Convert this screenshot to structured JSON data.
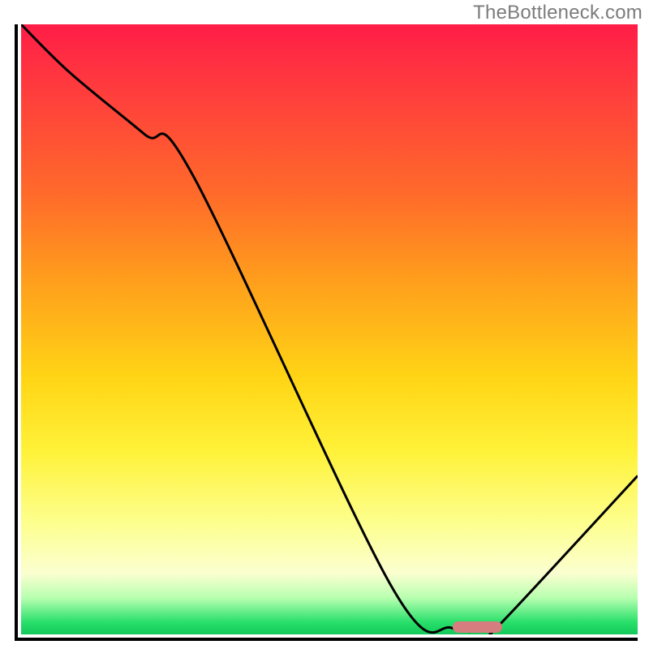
{
  "watermark": "TheBottleneck.com",
  "chart_data": {
    "type": "line",
    "title": "",
    "xlabel": "",
    "ylabel": "",
    "xlim": [
      0,
      100
    ],
    "ylim": [
      0,
      100
    ],
    "grid": false,
    "legend": false,
    "series": [
      {
        "name": "bottleneck-curve",
        "x": [
          0,
          8,
          20,
          28,
          60,
          70,
          76,
          78,
          100
        ],
        "y": [
          100,
          92,
          82,
          75,
          8,
          1,
          1,
          2,
          26
        ]
      }
    ],
    "optimal_range": {
      "x_start": 70,
      "x_end": 78,
      "y": 1
    },
    "gradient_stops": [
      {
        "pos": 0,
        "color": "#ff1d47"
      },
      {
        "pos": 10,
        "color": "#ff3a3e"
      },
      {
        "pos": 28,
        "color": "#ff6b2a"
      },
      {
        "pos": 42,
        "color": "#ff9e1c"
      },
      {
        "pos": 58,
        "color": "#ffd515"
      },
      {
        "pos": 70,
        "color": "#fff239"
      },
      {
        "pos": 82,
        "color": "#fdff90"
      },
      {
        "pos": 90,
        "color": "#fbffd0"
      },
      {
        "pos": 94,
        "color": "#b8ffb0"
      },
      {
        "pos": 98,
        "color": "#29e06b"
      },
      {
        "pos": 100,
        "color": "#13c85a"
      }
    ]
  }
}
